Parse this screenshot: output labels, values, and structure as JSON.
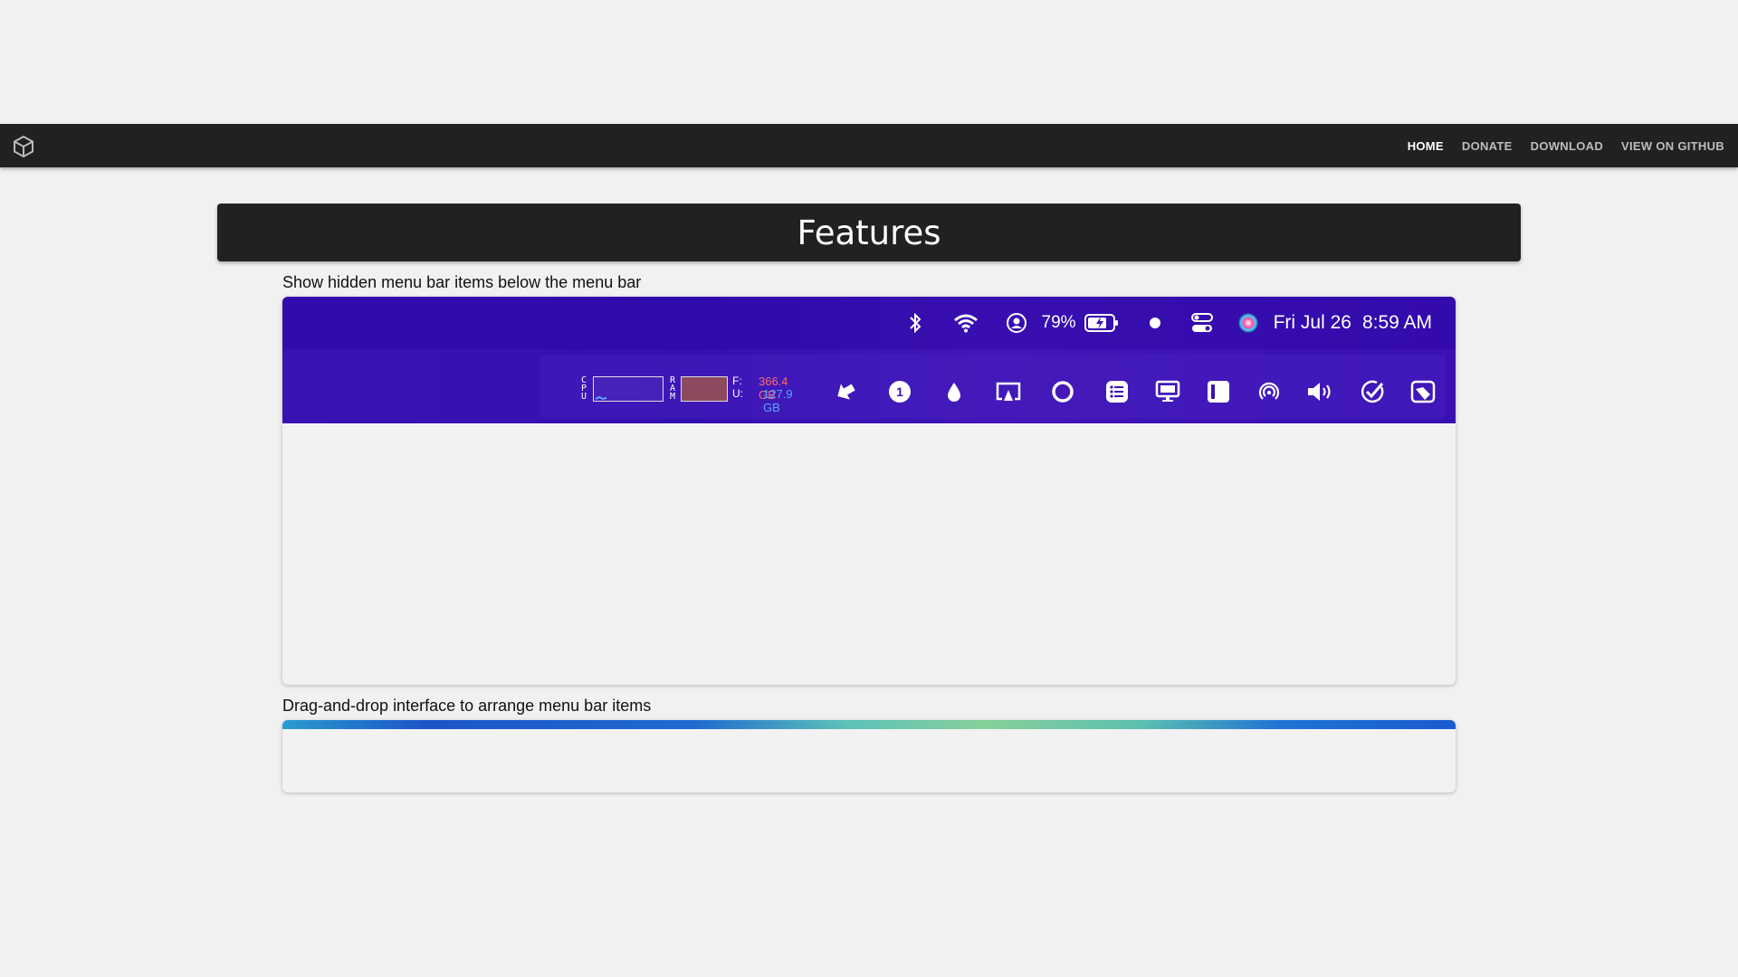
{
  "nav": {
    "logo_icon": "cube-icon",
    "links": [
      "HOME",
      "DONATE",
      "DOWNLOAD",
      "VIEW ON GITHUB"
    ],
    "active": "HOME"
  },
  "features": {
    "title": "Features"
  },
  "sections": [
    {
      "caption": "Show hidden menu bar items below the menu bar"
    },
    {
      "caption": "Drag-and-drop interface to arrange menu bar items"
    }
  ],
  "menubar": {
    "top_icons": [
      "bluetooth-icon",
      "wifi-icon",
      "user-icon",
      "battery-icon",
      "dot-icon",
      "control-center-icon",
      "siri-icon"
    ],
    "battery_percent": "79%",
    "date": "Fri Jul 26",
    "time": "8:59 AM",
    "stats": {
      "cpu_label": "CPU",
      "ram_label": "RAM",
      "disk_letters": [
        "F:",
        "U:"
      ],
      "disk_free": "366.4 GB",
      "disk_used": "127.9 GB"
    },
    "bottom_icons": [
      "cursor-icon",
      "onepassword-icon",
      "drop-icon",
      "airplay-icon",
      "circle-icon",
      "list-icon",
      "display-icon",
      "sidebar-icon",
      "airdrop-icon",
      "volume-icon",
      "checkmark-icon",
      "hand-icon"
    ]
  },
  "colors": {
    "nav_bg": "#212121",
    "menubar_purple": "#3a12b4",
    "disk_free": "#ff6a6a",
    "disk_used": "#5aa8ff"
  }
}
